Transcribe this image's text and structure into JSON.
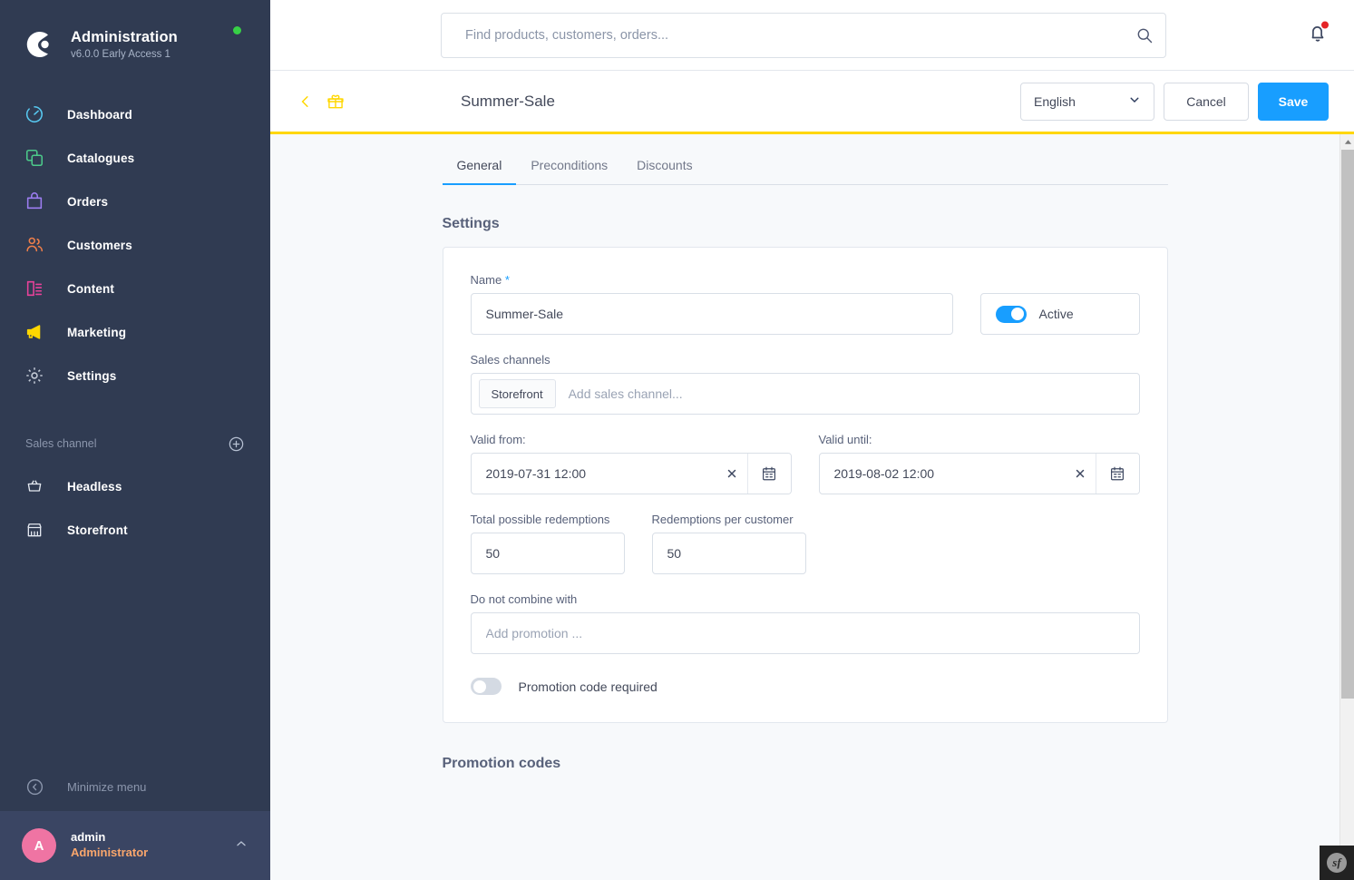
{
  "sidebar": {
    "brand": {
      "title": "Administration",
      "version": "v6.0.0 Early Access 1",
      "status_icon": "status-dot-online"
    },
    "items": [
      {
        "label": "Dashboard",
        "icon": "dashboard-icon",
        "color": "#57c7ef"
      },
      {
        "label": "Catalogues",
        "icon": "catalogues-icon",
        "color": "#4cc98a"
      },
      {
        "label": "Orders",
        "icon": "orders-icon",
        "color": "#9b7df0"
      },
      {
        "label": "Customers",
        "icon": "customers-icon",
        "color": "#ef7f4a"
      },
      {
        "label": "Content",
        "icon": "content-icon",
        "color": "#e8429a"
      },
      {
        "label": "Marketing",
        "icon": "marketing-icon",
        "color": "#ffd700"
      },
      {
        "label": "Settings",
        "icon": "settings-gear-icon",
        "color": "#c3cad6"
      }
    ],
    "sales_channel": {
      "label": "Sales channel",
      "add_icon": "plus-circle-icon",
      "items": [
        {
          "label": "Headless",
          "icon": "basket-icon"
        },
        {
          "label": "Storefront",
          "icon": "store-icon"
        }
      ]
    },
    "minimize": {
      "label": "Minimize menu",
      "icon": "chevron-left-circle-icon"
    },
    "user": {
      "initial": "A",
      "name": "admin",
      "role": "Administrator",
      "chevron_icon": "chevron-up-icon"
    }
  },
  "topbar": {
    "search": {
      "placeholder": "Find products, customers, orders...",
      "value": "",
      "icon": "search-icon"
    },
    "notifications": {
      "icon": "bell-icon",
      "has_badge": true
    }
  },
  "pagehead": {
    "back_icon": "chevron-left-icon",
    "module_icon": "gift-icon",
    "title": "Summer-Sale",
    "language": {
      "value": "English",
      "chevron_icon": "chevron-down-icon"
    },
    "cancel_label": "Cancel",
    "save_label": "Save",
    "accent_color": "#ffd700"
  },
  "tabs": [
    {
      "label": "General",
      "active": true
    },
    {
      "label": "Preconditions",
      "active": false
    },
    {
      "label": "Discounts",
      "active": false
    }
  ],
  "settings": {
    "heading": "Settings",
    "name": {
      "label": "Name",
      "required_marker": "*",
      "value": "Summer-Sale"
    },
    "active_toggle": {
      "label": "Active",
      "state": "on"
    },
    "sales_channels": {
      "label": "Sales channels",
      "chips": [
        "Storefront"
      ],
      "placeholder": "Add sales channel..."
    },
    "valid_from": {
      "label": "Valid from:",
      "value": "2019-07-31 12:00",
      "clear_icon": "close-icon",
      "calendar_icon": "calendar-icon"
    },
    "valid_until": {
      "label": "Valid until:",
      "value": "2019-08-02 12:00",
      "clear_icon": "close-icon",
      "calendar_icon": "calendar-icon"
    },
    "total_redemptions": {
      "label": "Total possible redemptions",
      "value": "50"
    },
    "redemptions_per_customer": {
      "label": "Redemptions per customer",
      "value": "50"
    },
    "do_not_combine": {
      "label": "Do not combine with",
      "placeholder": "Add promotion ...",
      "value": ""
    },
    "promotion_code_required": {
      "label": "Promotion code required",
      "state": "off"
    }
  },
  "promotion_codes": {
    "heading": "Promotion codes"
  },
  "profiler": {
    "label": "sf",
    "name": "symfony-profiler-badge"
  },
  "scrollbar": {
    "up_icon": "scroll-up-arrow"
  }
}
